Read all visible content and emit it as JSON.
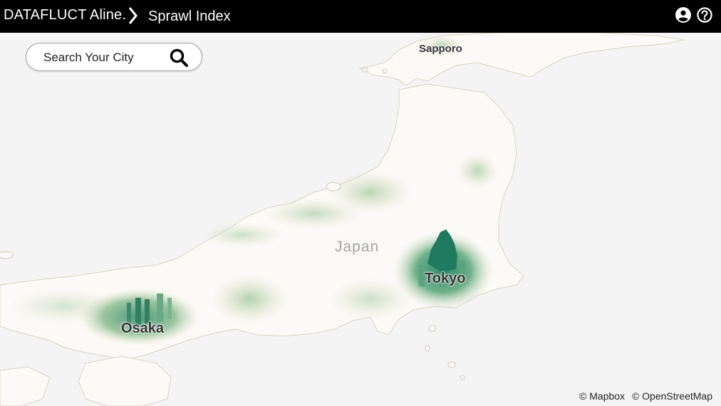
{
  "header": {
    "brand": "DATAFLUCT Aline.",
    "page_title": "Sprawl Index"
  },
  "search": {
    "placeholder": "Search Your City",
    "icon": "magnifier"
  },
  "map": {
    "country_label": "Japan",
    "cities": [
      {
        "name": "Sapporo"
      },
      {
        "name": "Tokyo"
      },
      {
        "name": "Osaka"
      }
    ],
    "attribution": [
      "© Mapbox",
      "© OpenStreetMap"
    ]
  },
  "colors": {
    "header_bg": "#000000",
    "background": "#f4f4f4",
    "land": "#fbfaf7",
    "sprawl_low": "#e6e0c8",
    "sprawl_mid": "#a9cda6",
    "sprawl_high": "#1f7a60"
  }
}
